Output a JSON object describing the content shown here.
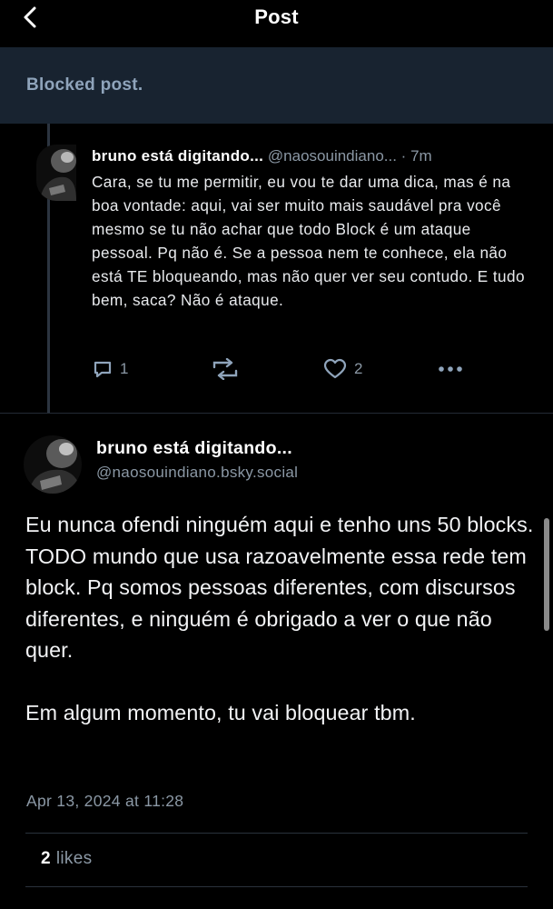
{
  "header": {
    "title": "Post",
    "back_icon": "chevron-left-icon"
  },
  "blocked_notice": {
    "text": "Blocked post."
  },
  "reply": {
    "display_name": "bruno está digitando...",
    "handle": "@naosouindiano...",
    "separator": " · ",
    "time": "7m",
    "text": "Cara, se tu me permitir, eu vou te dar uma dica, mas é na boa vontade: aqui, vai ser muito mais saudável pra você mesmo se tu não achar que todo Block é um ataque pessoal. Pq não é. Se a pessoa nem te conhece, ela não está TE bloqueando, mas não quer ver seu contudo. E tudo bem, saca? Não é ataque.",
    "actions": {
      "reply_count": "1",
      "repost_count": "",
      "like_count": "2"
    }
  },
  "main_post": {
    "display_name": "bruno está digitando...",
    "handle": "@naosouindiano.bsky.social",
    "paragraph_1": "Eu nunca ofendi ninguém aqui e tenho uns 50 blocks. TODO mundo que usa razoavelmente essa rede tem block. Pq somos pessoas diferentes, com discursos diferentes, e ninguém é obrigado a ver o que não quer.",
    "paragraph_2": "Em algum momento, tu vai bloquear tbm.",
    "timestamp": "Apr 13, 2024 at 11:28",
    "likes_count": "2",
    "likes_label": "likes"
  },
  "colors": {
    "background": "#000000",
    "blocked_banner": "#182330",
    "muted_text": "#8b98a5",
    "icon": "#8fa4bb"
  }
}
